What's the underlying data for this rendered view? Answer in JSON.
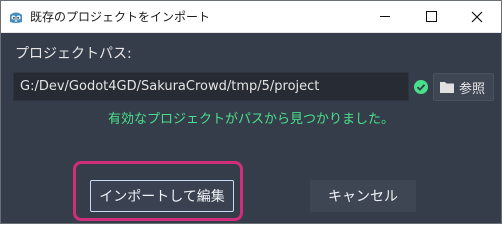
{
  "window": {
    "title": "既存のプロジェクトをインポート",
    "icon": "godot-icon"
  },
  "colors": {
    "background": "#363d4a",
    "success_text": "#48e08a",
    "highlight_border": "#d02d7b",
    "focus_border": "#c6d9f5"
  },
  "form": {
    "path_label": "プロジェクトパス:",
    "path_value": "G:/Dev/Godot4GD/SakuraCrowd/tmp/5/project",
    "browse_label": "参照",
    "status_message": "有効なプロジェクトがパスから見つかりました。"
  },
  "actions": {
    "import_edit_label": "インポートして編集",
    "cancel_label": "キャンセル"
  }
}
